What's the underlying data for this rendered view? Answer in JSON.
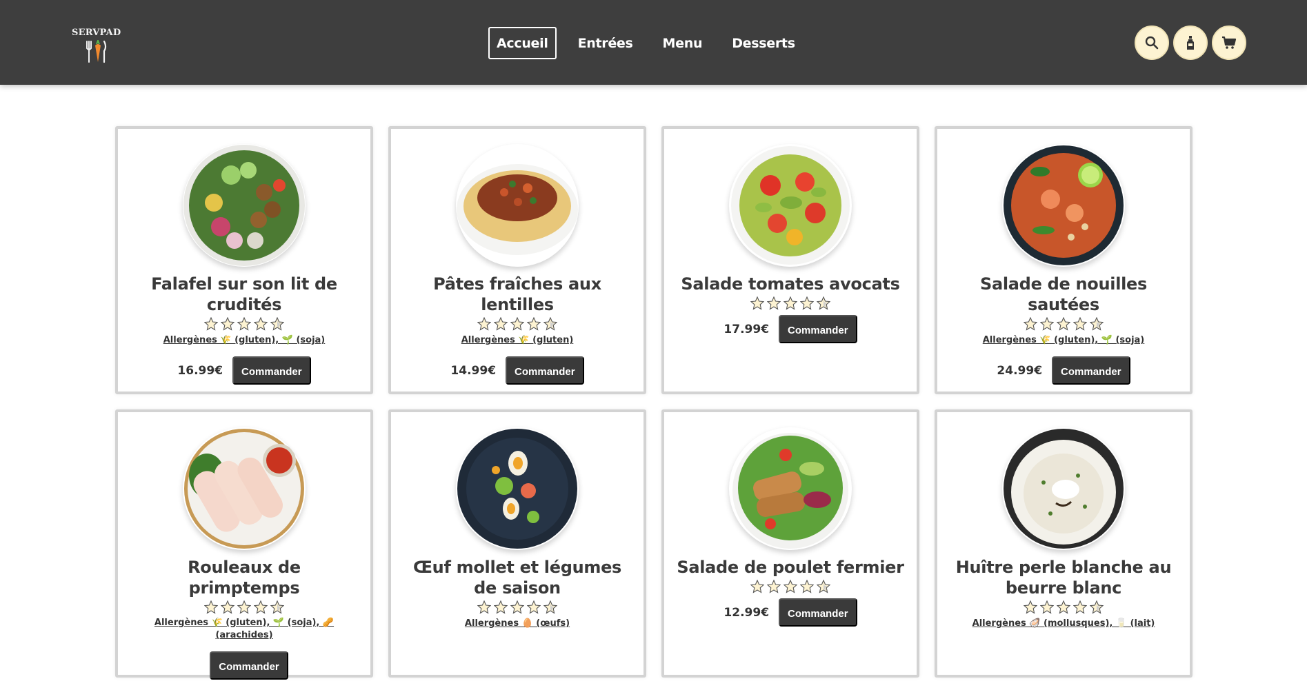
{
  "header": {
    "logo_text": "SERVPAD",
    "nav": [
      {
        "label": "Accueil",
        "active": true
      },
      {
        "label": "Entrées",
        "active": false
      },
      {
        "label": "Menu",
        "active": false
      },
      {
        "label": "Desserts",
        "active": false
      }
    ],
    "icons": [
      "search-icon",
      "bottle-icon",
      "cart-icon"
    ]
  },
  "products": [
    {
      "title": "Falafel sur son lit de crudités",
      "allergens": "Allergènes 🌾 (gluten), 🌱 (soja)",
      "price": "16.99€",
      "order_label": "Commander"
    },
    {
      "title": "Pâtes fraîches aux lentilles",
      "allergens": "Allergènes 🌾 (gluten)",
      "price": "14.99€",
      "order_label": "Commander"
    },
    {
      "title": "Salade tomates avocats",
      "allergens": "",
      "price": "17.99€",
      "order_label": "Commander"
    },
    {
      "title": "Salade de nouilles sautées",
      "allergens": "Allergènes 🌾 (gluten), 🌱 (soja)",
      "price": "24.99€",
      "order_label": "Commander"
    },
    {
      "title": "Rouleaux de primptemps",
      "allergens": "Allergènes 🌾 (gluten), 🌱 (soja), 🥜 (arachides)",
      "price": "",
      "order_label": "Commander"
    },
    {
      "title": "Œuf mollet et légumes de saison",
      "allergens": "Allergènes 🥚 (œufs)",
      "price": "",
      "order_label": ""
    },
    {
      "title": "Salade de poulet fermier",
      "allergens": "",
      "price": "12.99€",
      "order_label": "Commander"
    },
    {
      "title": "Huître perle blanche au beurre blanc",
      "allergens": "Allergènes 🦪 (mollusques), 🥛 (lait)",
      "price": "",
      "order_label": ""
    }
  ],
  "colors": {
    "header_bg": "#3e3e3e",
    "icon_button_bg": "#fdf3d2",
    "button_bg": "#3a3a3a",
    "card_border": "#d3d3d3",
    "star_fill": "#fdf3d2"
  }
}
